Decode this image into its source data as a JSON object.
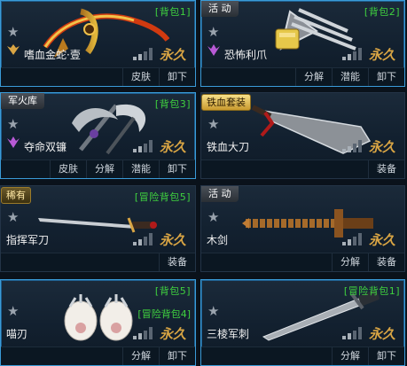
{
  "cards": [
    {
      "id": "c1",
      "pack": "[背包1]",
      "tag": "",
      "name": "嗜血金蛇·壹",
      "perm": "永久",
      "actions": [
        "皮肤",
        "卸下"
      ]
    },
    {
      "id": "c2",
      "pack": "[背包2]",
      "tag": "活 动",
      "name": "恐怖利爪",
      "perm": "永久",
      "actions": [
        "分解",
        "潜能",
        "卸下"
      ]
    },
    {
      "id": "c3",
      "pack": "[背包3]",
      "tag": "军火库",
      "name": "夺命双镰",
      "perm": "永久",
      "actions": [
        "皮肤",
        "分解",
        "潜能",
        "卸下"
      ]
    },
    {
      "id": "c4",
      "pack": "",
      "tag": "铁血套装",
      "name": "铁血大刀",
      "perm": "永久",
      "actions": [
        "装备"
      ]
    },
    {
      "id": "c5",
      "pack": "[冒险背包5]",
      "tag": "稀有",
      "name": "指挥军刀",
      "perm": "永久",
      "actions": [
        "装备"
      ]
    },
    {
      "id": "c6",
      "pack": "",
      "tag": "活 动",
      "name": "木剑",
      "perm": "永久",
      "actions": [
        "分解",
        "装备"
      ]
    },
    {
      "id": "c7",
      "pack": "[背包5]",
      "pack2": "[冒险背包4]",
      "tag": "",
      "name": "喵刃",
      "perm": "永久",
      "actions": [
        "分解",
        "卸下"
      ]
    },
    {
      "id": "c8",
      "pack": "[冒险背包1]",
      "tag": "",
      "name": "三棱军刺",
      "perm": "永久",
      "actions": [
        "分解",
        "卸下"
      ]
    }
  ],
  "icons": {
    "star": "star-icon",
    "signal": "signal-bars-icon",
    "badge": "claw-emblem-icon"
  },
  "colors": {
    "accent": "#3fd13f",
    "permanent": "#d9a544",
    "highlight": "#3a9bd8"
  }
}
